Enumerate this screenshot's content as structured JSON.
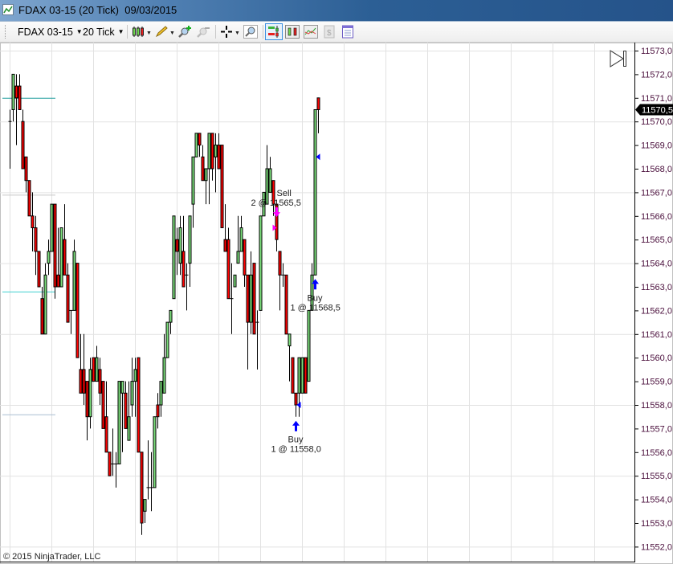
{
  "window": {
    "title": "FDAX 03-15 (20 Tick)  09/03/2015",
    "icon": "chart-line-icon"
  },
  "toolbar": {
    "instrument": "FDAX 03-15",
    "interval": "20 Tick",
    "icons": [
      "candlestick-style-icon",
      "pencil-draw-icon",
      "zoom-in-icon",
      "zoom-out-icon",
      "crosshair-icon",
      "magnifier-icon",
      "chart-trader-icon",
      "indicators-icon",
      "strategies-icon",
      "data-box-icon",
      "properties-icon"
    ],
    "selected": "chart-trader-icon"
  },
  "copyright": "© 2015 NinjaTrader, LLC",
  "chart_data": {
    "type": "candlestick",
    "ylim": [
      11552,
      11573
    ],
    "y_tick_labels": [
      "11573,0",
      "11572,0",
      "11571,0",
      "11570,0",
      "11569,0",
      "11568,0",
      "11567,0",
      "11566,0",
      "11565,0",
      "11564,0",
      "11563,0",
      "11562,0",
      "11561,0",
      "11560,0",
      "11559,0",
      "11558,0",
      "11557,0",
      "11556,0",
      "11555,0",
      "11554,0",
      "11553,0",
      "11552,0"
    ],
    "y_tick_values": [
      11573,
      11572,
      11571,
      11570,
      11569,
      11568,
      11567,
      11566,
      11565,
      11564,
      11563,
      11562,
      11561,
      11560,
      11559,
      11558,
      11557,
      11556,
      11555,
      11554,
      11553,
      11552
    ],
    "grid": true,
    "current_price": 11570.5,
    "current_price_label": "11570,5",
    "colors": {
      "up": "#7ce07c",
      "down": "#ff0000",
      "outline": "#000000",
      "sell": "#ff00ff",
      "buy": "#0000ff",
      "grid": "#e2e2e2"
    },
    "ohlc_columns": [
      "open",
      "high",
      "low",
      "close"
    ],
    "ohlc": [
      [
        11570,
        11570.5,
        11568,
        11570
      ],
      [
        11570.5,
        11572,
        11570,
        11572
      ],
      [
        11571.5,
        11572,
        11569,
        11571
      ],
      [
        11571.5,
        11572,
        11570.5,
        11570.5
      ],
      [
        11570,
        11570.5,
        11568,
        11568
      ],
      [
        11568.5,
        11568.5,
        11567,
        11567.5
      ],
      [
        11567.5,
        11567.5,
        11566,
        11566
      ],
      [
        11566,
        11567,
        11564.5,
        11565.5
      ],
      [
        11565.5,
        11566,
        11563.5,
        11564.5
      ],
      [
        11564.5,
        11564.5,
        11563,
        11563
      ],
      [
        11562.5,
        11563,
        11561,
        11561
      ],
      [
        11561,
        11564,
        11561,
        11563.5
      ],
      [
        11564,
        11565,
        11563.5,
        11564.5
      ],
      [
        11564.5,
        11566.5,
        11564.5,
        11566.5
      ],
      [
        11566.5,
        11566.5,
        11562.5,
        11563
      ],
      [
        11563.5,
        11565.5,
        11563,
        11563
      ],
      [
        11563,
        11565.5,
        11563,
        11565.5
      ],
      [
        11565,
        11566.5,
        11563.5,
        11563.5
      ],
      [
        11563.5,
        11564,
        11561.5,
        11561.5
      ],
      [
        11562,
        11562,
        11561,
        11562
      ],
      [
        11562,
        11565,
        11562,
        11564.5
      ],
      [
        11564,
        11564,
        11560,
        11560
      ],
      [
        11559.5,
        11561,
        11558.5,
        11558.5
      ],
      [
        11559.5,
        11561,
        11558,
        11558.5
      ],
      [
        11559,
        11559,
        11556.5,
        11557.5
      ],
      [
        11557.5,
        11560,
        11557,
        11559.5
      ],
      [
        11560,
        11560,
        11559,
        11559
      ],
      [
        11559,
        11560.5,
        11559,
        11560
      ],
      [
        11559.5,
        11560,
        11558,
        11558.5
      ],
      [
        11559,
        11559,
        11557,
        11557
      ],
      [
        11557.5,
        11559,
        11556,
        11556
      ],
      [
        11556,
        11556,
        11555,
        11555
      ],
      [
        11555.5,
        11557,
        11555,
        11555.5
      ],
      [
        11555.5,
        11556,
        11554.5,
        11555.5
      ],
      [
        11555.5,
        11559,
        11555.5,
        11559
      ],
      [
        11558.5,
        11559,
        11556,
        11559
      ],
      [
        11558.5,
        11559,
        11557,
        11557
      ],
      [
        11556.5,
        11559,
        11556.5,
        11557.5
      ],
      [
        11558,
        11560,
        11557.5,
        11559
      ],
      [
        11559,
        11560,
        11557.5,
        11559.5
      ],
      [
        11560,
        11560,
        11556,
        11556
      ],
      [
        11556,
        11556,
        11552.5,
        11553
      ],
      [
        11553.5,
        11554,
        11553,
        11554
      ],
      [
        11554.5,
        11556.5,
        11554,
        11554.5
      ],
      [
        11554.5,
        11556,
        11553.5,
        11554.5
      ],
      [
        11554.5,
        11557.5,
        11554.5,
        11557.5
      ],
      [
        11558,
        11558.5,
        11557,
        11557.5
      ],
      [
        11558,
        11559,
        11557.5,
        11559
      ],
      [
        11558.5,
        11561,
        11558.5,
        11560
      ],
      [
        11560,
        11561.5,
        11560,
        11561.5
      ],
      [
        11561.5,
        11562,
        11561,
        11562
      ],
      [
        11562.5,
        11566,
        11562.5,
        11566
      ],
      [
        11565,
        11565.5,
        11563.5,
        11564.5
      ],
      [
        11564,
        11566,
        11563.5,
        11565.5
      ],
      [
        11564.5,
        11566,
        11563,
        11563
      ],
      [
        11563.5,
        11564,
        11562,
        11563.5
      ],
      [
        11564,
        11566,
        11563,
        11566
      ],
      [
        11566.5,
        11568.5,
        11565.5,
        11568.5
      ],
      [
        11568.5,
        11569.5,
        11568.5,
        11569.5
      ],
      [
        11569.5,
        11569.5,
        11568.5,
        11569
      ],
      [
        11568.5,
        11569,
        11567.5,
        11567.5
      ],
      [
        11567.5,
        11568,
        11566.5,
        11568
      ],
      [
        11568,
        11569.5,
        11566.5,
        11569.5
      ],
      [
        11569.5,
        11569.5,
        11567.5,
        11568
      ],
      [
        11568.5,
        11569.5,
        11567,
        11569
      ],
      [
        11569,
        11569.5,
        11568,
        11568
      ],
      [
        11569,
        11569,
        11565.5,
        11565.5
      ],
      [
        11565,
        11566.5,
        11564.5,
        11564.5
      ],
      [
        11565,
        11565.5,
        11562.5,
        11562.5
      ],
      [
        11562.5,
        11564,
        11561,
        11562.5
      ],
      [
        11563,
        11563.5,
        11563,
        11563.5
      ],
      [
        11564,
        11566,
        11564,
        11564.5
      ],
      [
        11564.5,
        11566,
        11564.5,
        11565.5
      ],
      [
        11565,
        11565,
        11563,
        11563.5
      ],
      [
        11563.5,
        11563.5,
        11559.5,
        11561.5
      ],
      [
        11561.5,
        11564.5,
        11561,
        11563.5
      ],
      [
        11564,
        11564,
        11561,
        11561
      ],
      [
        11561.5,
        11562,
        11559.5,
        11561.5
      ],
      [
        11562,
        11566,
        11562,
        11566
      ],
      [
        11566,
        11567,
        11566,
        11567
      ],
      [
        11566.5,
        11569,
        11566.5,
        11568
      ],
      [
        11567,
        11568.5,
        11567,
        11568
      ],
      [
        11567.5,
        11567.5,
        11566,
        11566.5
      ],
      [
        11566.5,
        11566.5,
        11564.5,
        11565
      ],
      [
        11564.5,
        11564.5,
        11562,
        11563.5
      ],
      [
        11563.5,
        11564,
        11563,
        11563.5
      ],
      [
        11563.5,
        11563.5,
        11561,
        11561
      ],
      [
        11560.5,
        11561,
        11559,
        11561
      ],
      [
        11560,
        11560,
        11558.5,
        11558.5
      ],
      [
        11558.5,
        11558.5,
        11557.5,
        11558
      ],
      [
        11558.5,
        11560,
        11557.5,
        11560
      ],
      [
        11558.5,
        11560,
        11558.5,
        11560
      ],
      [
        11560,
        11560,
        11558.5,
        11558.5
      ],
      [
        11559,
        11562,
        11559,
        11562
      ],
      [
        11562,
        11564,
        11562,
        11563.5
      ],
      [
        11563.5,
        11570.5,
        11563.5,
        11570.5
      ],
      [
        11571,
        11571,
        11569.5,
        11570.5
      ]
    ],
    "executions": [
      {
        "side": "Sell",
        "bar": 84,
        "price": 11565.5,
        "text1": "Sell",
        "text2": "2 @ 11565,5"
      },
      {
        "side": "Buy",
        "bar": 90,
        "price": 11558.0,
        "text1": "Buy",
        "text2": "1 @ 11558,0"
      },
      {
        "side": "Buy",
        "bar": 96,
        "price": 11568.5,
        "text1": "Buy",
        "text2": "1 @ 11568,5"
      }
    ],
    "horizontal_lines": [
      {
        "price": 11571.0,
        "color": "#1a9a9a"
      },
      {
        "price": 11566.9,
        "color": "#c8c8c8"
      },
      {
        "price": 11562.8,
        "color": "#3fd0d0"
      },
      {
        "price": 11557.6,
        "color": "#a9bed2"
      }
    ]
  }
}
